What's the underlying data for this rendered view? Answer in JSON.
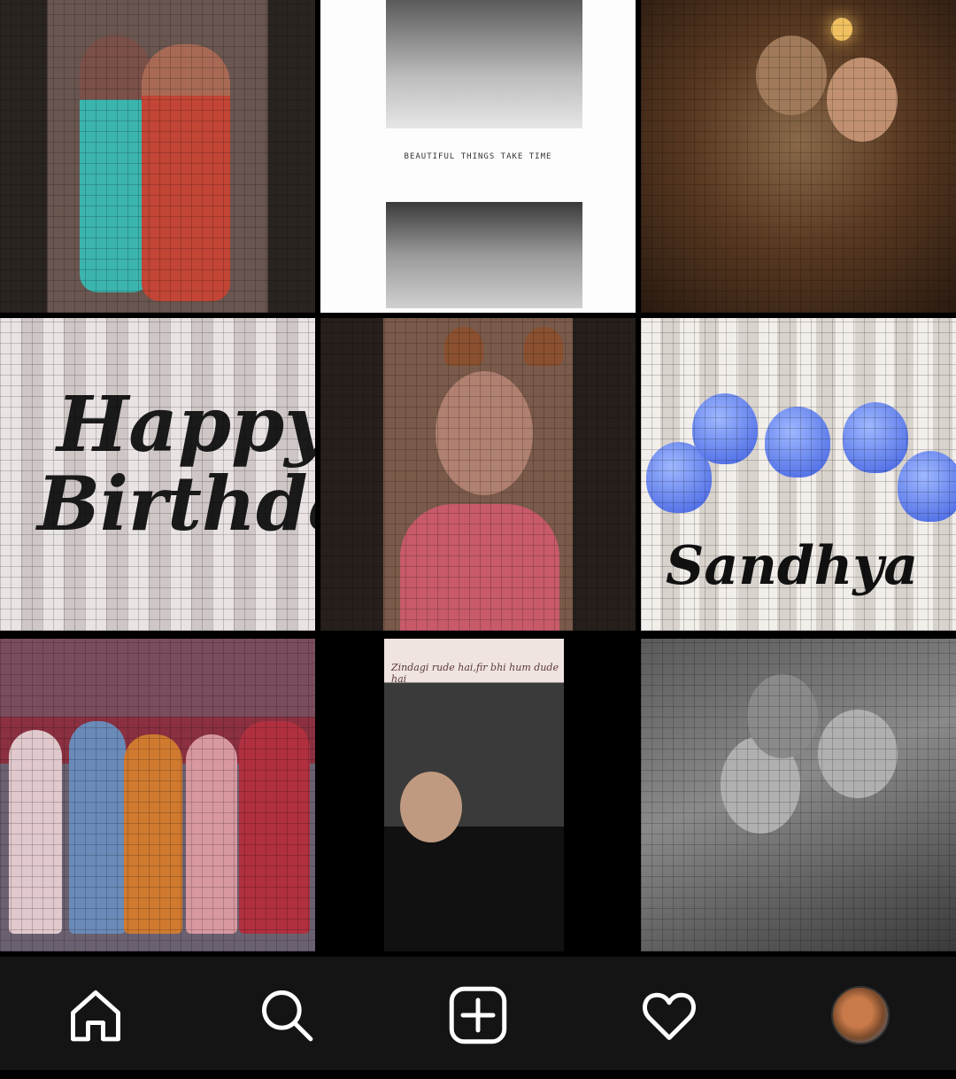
{
  "grid": {
    "tiles": [
      {
        "name": "post-couple-mosaic"
      },
      {
        "name": "post-beautiful-things",
        "quote": "BEAUTIFUL THINGS TAKE TIME"
      },
      {
        "name": "post-cafe-couple"
      },
      {
        "name": "post-happy-birthday",
        "line1": "Happy",
        "line2": "Birthday"
      },
      {
        "name": "post-dog-filter"
      },
      {
        "name": "post-sandhya",
        "title": "Sandhya"
      },
      {
        "name": "post-family-group"
      },
      {
        "name": "post-cafe-girl",
        "caption": "Zindagi rude hai,fir bhi hum dude hai"
      },
      {
        "name": "post-bw-family"
      }
    ]
  },
  "navbar": {
    "icons": [
      "home-icon",
      "search-icon",
      "add-post-icon",
      "heart-icon",
      "profile-avatar"
    ],
    "colors": {
      "background": "#141414",
      "icon": "#ffffff"
    }
  }
}
